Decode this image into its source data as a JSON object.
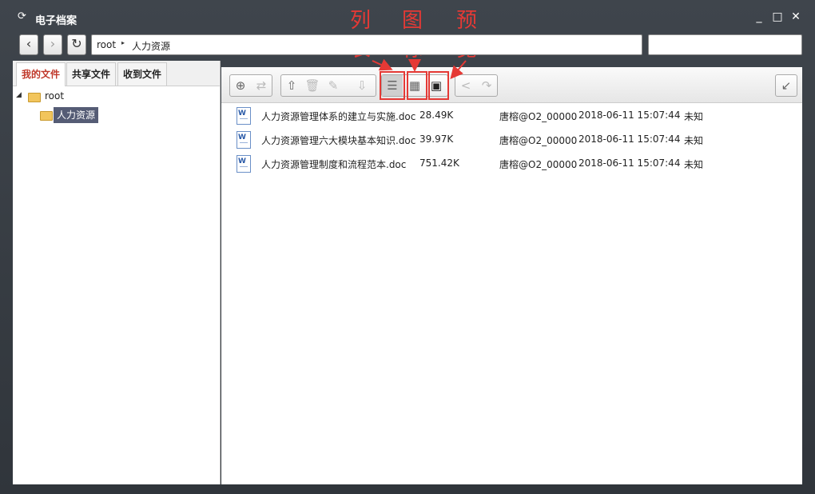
{
  "window": {
    "title": "电子档案",
    "minimize": "_",
    "maximize": "□",
    "close": "✕"
  },
  "annotations": {
    "list_char1": "列",
    "list_char2": "表",
    "icon_char1": "图",
    "icon_char2": "标",
    "preview_char1": "预",
    "preview_char2": "览",
    "color": "#e53935"
  },
  "nav": {
    "back": "‹",
    "forward": "›",
    "refresh": "↻",
    "path_root": "root",
    "path_sep": "▸",
    "path_folder": "人力资源",
    "search_value": ""
  },
  "tabs": [
    "我的文件",
    "共享文件",
    "收到文件"
  ],
  "tree": {
    "toggle": "◢",
    "root": "root",
    "child": "人力资源"
  },
  "toolbar": {
    "new_folder": "⊕",
    "move": "⇄",
    "upload": "⇧",
    "delete": "🗑",
    "edit": "✎",
    "download": "⇩",
    "view_list": "☰",
    "view_icons": "▦",
    "view_preview": "▣",
    "share": "<",
    "forward": "↷",
    "collapse": "↙"
  },
  "files": [
    {
      "name": "人力资源管理体系的建立与实施.doc",
      "size": "28.49K",
      "owner": "唐榕@O2_00000",
      "date": "2018-06-11 15:07:44",
      "status": "未知"
    },
    {
      "name": "人力资源管理六大模块基本知识.doc",
      "size": "39.97K",
      "owner": "唐榕@O2_00000",
      "date": "2018-06-11 15:07:44",
      "status": "未知"
    },
    {
      "name": "人力资源管理制度和流程范本.doc",
      "size": "751.42K",
      "owner": "唐榕@O2_00000",
      "date": "2018-06-11 15:07:44",
      "status": "未知"
    }
  ],
  "colors": {
    "selected_tree_bg": "#555c75",
    "active_tab_text": "#c0392b"
  }
}
